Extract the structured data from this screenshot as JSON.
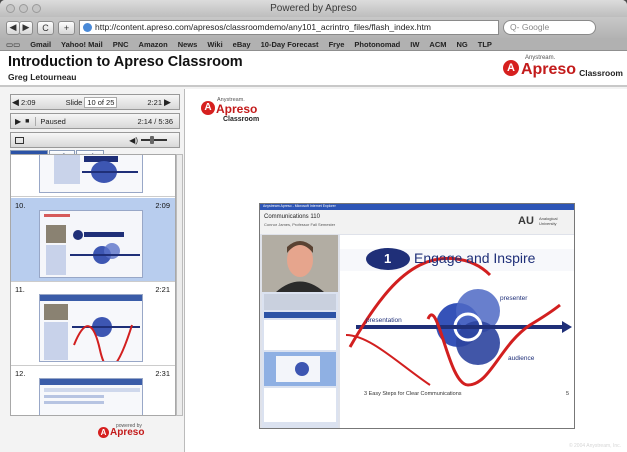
{
  "window": {
    "title": "Powered by Apreso"
  },
  "toolbar": {
    "back": "◀",
    "forward": "▶",
    "reload": "C",
    "add": "+",
    "url": "http://content.apreso.com/apresos/classroomdemo/any101_acrintro_files/flash_index.htm",
    "search_placeholder": "Google"
  },
  "bookmarks": [
    "Gmail",
    "Yahoo! Mail",
    "PNC",
    "Amazon",
    "News",
    "Wiki",
    "eBay",
    "10-Day Forecast",
    "Frye",
    "Photonomad",
    "IW",
    "ACM",
    "NG",
    "TLP"
  ],
  "header": {
    "title": "Introduction to Apreso Classroom",
    "author": "Greg Letourneau",
    "logo_small": "Anystream.",
    "logo_big": "Apreso",
    "logo_suffix": "Classroom"
  },
  "player": {
    "prev_time": "2:09",
    "slide_label": "Slide",
    "slide_value": "10 of 25",
    "next_time": "2:21",
    "status": "Paused",
    "elapsed": "2:14 / 5:36"
  },
  "tabs": [
    "Scenes",
    "Info",
    "Help"
  ],
  "scenes": [
    {
      "num": "10.",
      "time": "2:09"
    },
    {
      "num": "11.",
      "time": "2:21"
    },
    {
      "num": "12.",
      "time": "2:31"
    }
  ],
  "panel_logo": {
    "small": "powered by",
    "big": "Apreso"
  },
  "main_logo": {
    "small": "Anystream.",
    "big": "Apreso",
    "suffix": "Classroom"
  },
  "slide": {
    "window_title": "Anystream Apreso - Microsoft Internet Explorer",
    "course": "Communications 110",
    "instructor": "Connor James, Professor Fall Semester",
    "org_mark": "AU",
    "org_name": "Analogical University",
    "step_num": "1",
    "heading": "Engage and Inspire",
    "label_presenter": "presenter",
    "label_presentation": "presentation",
    "label_audience": "audience",
    "caption": "3 Easy Steps for Clear Communications",
    "page": "5"
  },
  "colors": {
    "brand_red": "#c31b1b",
    "tab_blue": "#2c53a6",
    "selection": "#b8cdee",
    "slide_navy": "#1f2f78"
  }
}
